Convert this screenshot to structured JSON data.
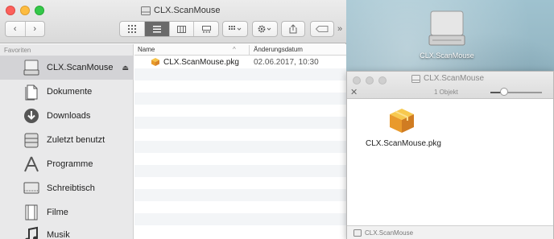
{
  "finder": {
    "title": "CLX.ScanMouse",
    "more": "»"
  },
  "sidebar": {
    "heading": "Favoriten",
    "items": [
      {
        "label": "CLX.ScanMouse",
        "icon": "disk-icon"
      },
      {
        "label": "Dokumente",
        "icon": "documents-icon"
      },
      {
        "label": "Downloads",
        "icon": "downloads-icon"
      },
      {
        "label": "Zuletzt benutzt",
        "icon": "recent-icon"
      },
      {
        "label": "Programme",
        "icon": "applications-icon"
      },
      {
        "label": "Schreibtisch",
        "icon": "desktop-icon"
      },
      {
        "label": "Filme",
        "icon": "movies-icon"
      },
      {
        "label": "Musik",
        "icon": "music-icon"
      }
    ],
    "eject": "⏏"
  },
  "list": {
    "col_name": "Name",
    "col_date": "Änderungsdatum",
    "sort_arrow": "^",
    "file": {
      "name": "CLX.ScanMouse.pkg",
      "date": "02.06.2017, 10:30"
    }
  },
  "win2": {
    "title": "CLX.ScanMouse",
    "count": "1 Objekt",
    "close": "✕",
    "item_label": "CLX.ScanMouse.pkg",
    "status_path": "CLX.ScanMouse"
  },
  "desktop": {
    "disk_label": "CLX.ScanMouse"
  },
  "colors": {
    "close": "#fc605b",
    "minimize": "#fdbc40",
    "maximize": "#34c84a",
    "selection": "#d3d3d6"
  }
}
